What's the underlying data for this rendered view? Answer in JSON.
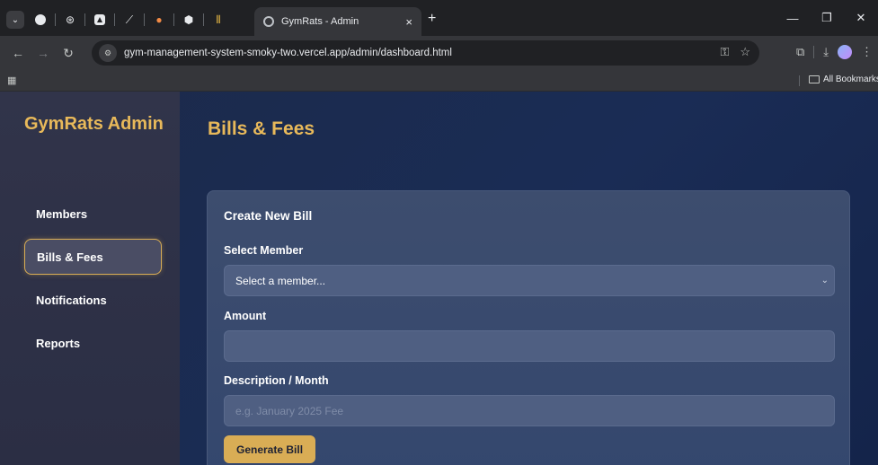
{
  "browser": {
    "tab_title": "GymRats - Admin",
    "tab_close": "×",
    "new_tab": "+",
    "url": "gym-management-system-smoky-two.vercel.app/admin/dashboard.html",
    "all_bookmarks": "All Bookmarks",
    "controls": {
      "minimize": "—",
      "restore": "❐",
      "close": "✕"
    }
  },
  "sidebar": {
    "brand": "GymRats Admin",
    "items": [
      {
        "label": "Members",
        "active": false
      },
      {
        "label": "Bills & Fees",
        "active": true
      },
      {
        "label": "Notifications",
        "active": false
      },
      {
        "label": "Reports",
        "active": false
      }
    ]
  },
  "main": {
    "title": "Bills & Fees",
    "card": {
      "title": "Create New Bill",
      "member_label": "Select Member",
      "member_selected": "Select a member...",
      "amount_label": "Amount",
      "amount_value": "",
      "description_label": "Description / Month",
      "description_placeholder": "e.g. January 2025 Fee",
      "submit_label": "Generate Bill"
    }
  },
  "colors": {
    "accent": "#d9ad55",
    "brand_text": "#e8b95a",
    "sidebar_bg": "#2e3146",
    "card_bg": "#3a4b6e",
    "input_bg": "#4f5f82"
  }
}
